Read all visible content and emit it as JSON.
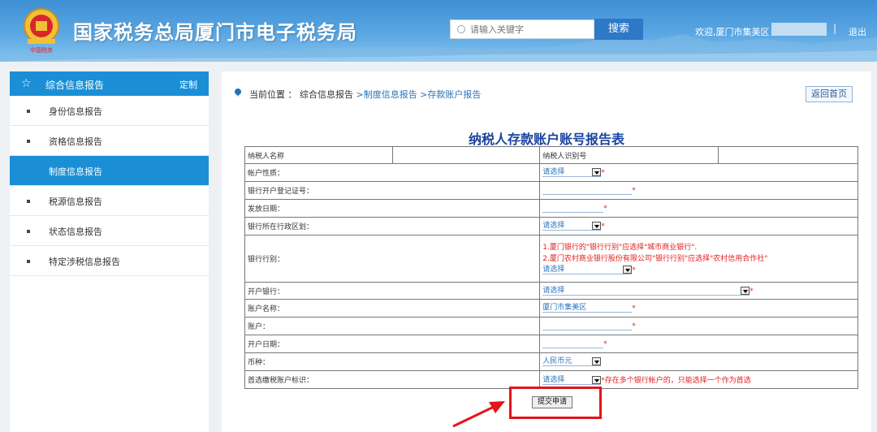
{
  "header": {
    "title": "国家税务总局厦门市电子税务局",
    "emblem_caption": "中国税务",
    "search_placeholder": "请输入关键字",
    "search_button": "搜索",
    "welcome": "欢迎,厦门市集美区",
    "separator": "|",
    "logout": "退出"
  },
  "sidebar": {
    "title": "综合信息报告",
    "customize": "定制",
    "items": [
      {
        "label": "身份信息报告",
        "active": false
      },
      {
        "label": "资格信息报告",
        "active": false
      },
      {
        "label": "制度信息报告",
        "active": true
      },
      {
        "label": "税源信息报告",
        "active": false
      },
      {
        "label": "状态信息报告",
        "active": false
      },
      {
        "label": "特定涉税信息报告",
        "active": false
      }
    ]
  },
  "breadcrumb": {
    "prefix": "当前位置 ： 综合信息报告",
    "link1": " >制度信息报告",
    "link2": " >存款账户报告"
  },
  "back_button": "返回首页",
  "form": {
    "title": "纳税人存款账户账号报告表",
    "taxpayer_name_label": "纳税人名称",
    "taxpayer_id_label": "纳税人识别号",
    "account_nature_label": "帐户性质：",
    "bank_reg_no_label": "银行开户登记证号：",
    "issue_date_label": "发放日期：",
    "bank_region_label": "银行所在行政区划：",
    "bank_type_label": "银行行别：",
    "bank_type_note1": "1.厦门银行的\"银行行别\"应选择\"城市商业银行\".",
    "bank_type_note2": "2.厦门农村商业银行股份有限公司\"银行行别\"应选择\"农村信用合作社\"",
    "open_bank_label": "开户银行：",
    "account_name_label": "账户名称：",
    "account_name_value": "厦门市集美区",
    "account_label": "账户：",
    "open_date_label": "开户日期：",
    "currency_label": "币种：",
    "currency_value": "人民币元",
    "preferred_label": "首选缴税账户标识：",
    "preferred_note": "存在多个银行帐户的，只能选择一个作为首选",
    "please_select": "请选择",
    "required_mark": "*"
  },
  "submit_button": "提交申请",
  "colors": {
    "header_blue": "#4f9fde",
    "sidebar_active": "#1b8fd6",
    "link_blue": "#2a72b8",
    "title_blue": "#1a44a0",
    "highlight_red": "#e3141b"
  }
}
